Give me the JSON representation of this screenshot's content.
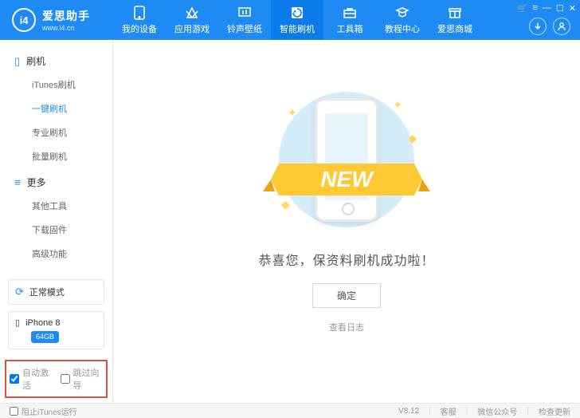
{
  "brand": {
    "name": "爱思助手",
    "url": "www.i4.cn",
    "logo_text": "i4"
  },
  "nav": [
    {
      "label": "我的设备",
      "icon": "device"
    },
    {
      "label": "应用游戏",
      "icon": "apps"
    },
    {
      "label": "铃声壁纸",
      "icon": "music"
    },
    {
      "label": "智能刷机",
      "icon": "flash",
      "active": true
    },
    {
      "label": "工具箱",
      "icon": "toolbox"
    },
    {
      "label": "教程中心",
      "icon": "tutorial"
    },
    {
      "label": "爱思商城",
      "icon": "store"
    }
  ],
  "sidebar": {
    "g1": {
      "title": "刷机",
      "items": [
        "iTunes刷机",
        "一键刷机",
        "专业刷机",
        "批量刷机"
      ],
      "active_index": 1
    },
    "g2": {
      "title": "更多",
      "items": [
        "其他工具",
        "下载固件",
        "高级功能"
      ]
    }
  },
  "mode": {
    "label": "正常模式"
  },
  "device": {
    "name": "iPhone 8",
    "storage": "64GB"
  },
  "checks": {
    "auto_activate": "自动激活",
    "auto_activate_checked": true,
    "skip_guide": "跳过向导",
    "skip_guide_checked": false
  },
  "main": {
    "message": "恭喜您，保资料刷机成功啦！",
    "ok": "确定",
    "log": "查看日志",
    "ribbon": "NEW"
  },
  "footer": {
    "block_itunes": "阻止iTunes运行",
    "block_checked": false,
    "version": "V8.12",
    "links": [
      "客服",
      "微信公众号",
      "检查更新"
    ]
  }
}
